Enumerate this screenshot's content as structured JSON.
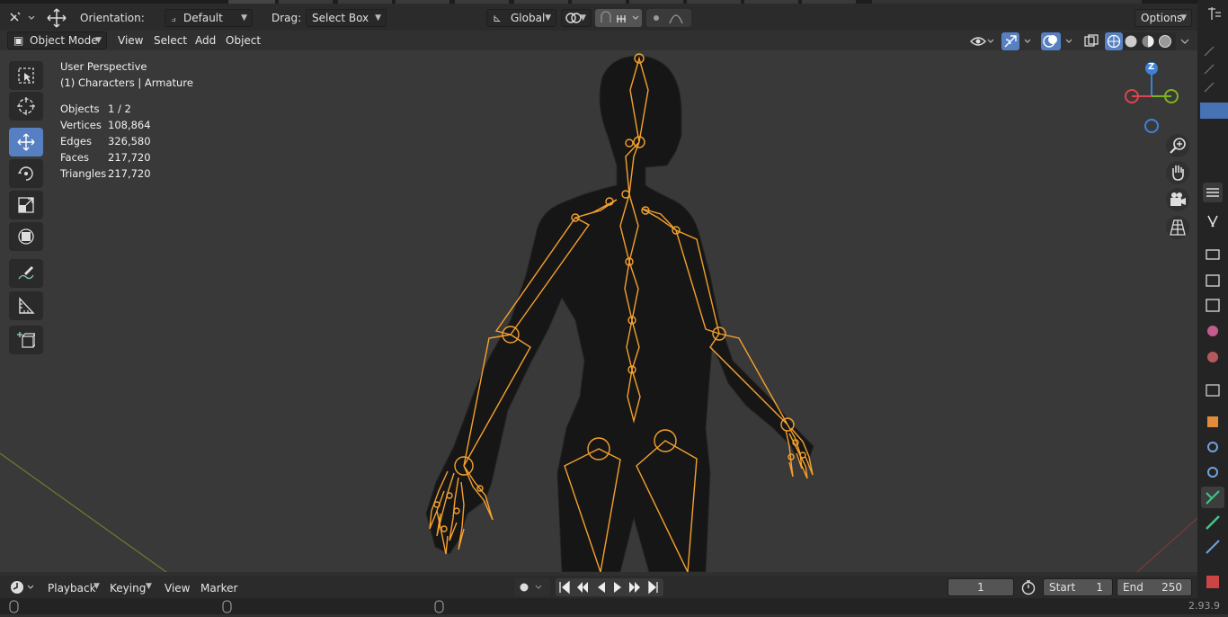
{
  "header": {
    "orientation_label": "Orientation:",
    "orientation_value": "Default",
    "drag_label": "Drag:",
    "drag_value": "Select Box",
    "transform_orientation": "Global",
    "options_label": "Options"
  },
  "modebar": {
    "mode": "Object Mode",
    "menus": [
      "View",
      "Select",
      "Add",
      "Object"
    ]
  },
  "viewport": {
    "view_name": "User Perspective",
    "collection_info": "(1) Characters | Armature",
    "stats": [
      {
        "label": "Objects",
        "value": "1 / 2"
      },
      {
        "label": "Vertices",
        "value": "108,864"
      },
      {
        "label": "Edges",
        "value": "326,580"
      },
      {
        "label": "Faces",
        "value": "217,720"
      },
      {
        "label": "Triangles",
        "value": "217,720"
      }
    ],
    "gizmo_axis_z": "Z"
  },
  "timeline": {
    "menus": [
      "Playback",
      "Keying",
      "View",
      "Marker"
    ],
    "current_frame": "1",
    "start_label": "Start",
    "start_value": "1",
    "end_label": "End",
    "end_value": "250"
  },
  "statusbar": {
    "version": "2.93.9"
  },
  "colors": {
    "accent": "#5680c2",
    "armature": "#f5a12e",
    "axis_x": "#e0434f",
    "axis_y": "#7eb320",
    "axis_z": "#3d82d9"
  },
  "icons": [
    "editor-type-icon",
    "move-icon",
    "transform-orientation-icon",
    "snap-icon",
    "proportional-icon",
    "select-box-tool-icon",
    "cursor-tool-icon",
    "move-tool-icon",
    "rotate-tool-icon",
    "scale-tool-icon",
    "transform-tool-icon",
    "annotate-tool-icon",
    "measure-tool-icon",
    "add-cube-tool-icon",
    "zoom-icon",
    "hand-pan-icon",
    "camera-icon",
    "grid-perspective-icon"
  ]
}
